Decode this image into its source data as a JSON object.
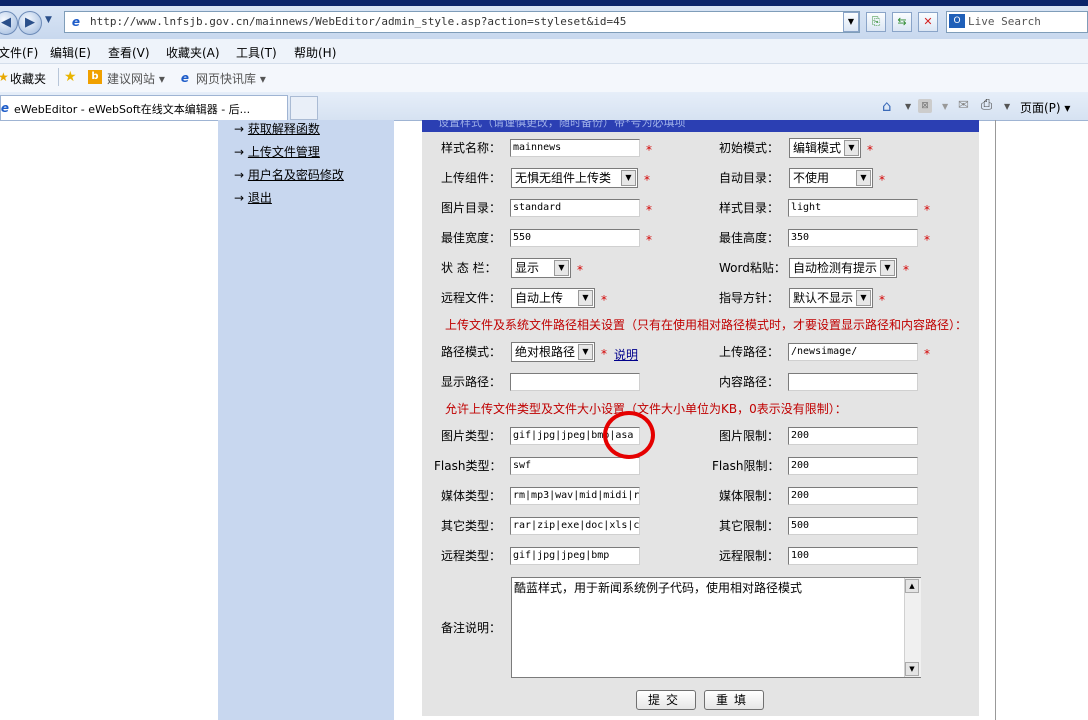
{
  "browser": {
    "url": "http://www.lnfsjb.gov.cn/mainnews/WebEditor/admin_style.asp?action=styleset&id=45",
    "search_placeholder": "Live Search",
    "menu": [
      "文件(F)",
      "编辑(E)",
      "查看(V)",
      "收藏夹(A)",
      "工具(T)",
      "帮助(H)"
    ],
    "favorites_label": "收藏夹",
    "favorites_items": [
      "建议网站 ▾",
      "网页快讯库 ▾"
    ],
    "tab_title": "eWebEditor - eWebSoft在线文本编辑器 - 后...",
    "page_menu_label": "页面(P) ▾"
  },
  "sidebar": {
    "links": [
      "获取解释函数",
      "上传文件管理",
      "用户名及密码修改",
      "退出"
    ]
  },
  "form": {
    "header_text": "设置样式（请谨慎更改，随时备份）带*号为必填项",
    "star": "*",
    "fields": {
      "style_name": {
        "label": "样式名称：",
        "value": "mainnews"
      },
      "init_mode": {
        "label": "初始模式：",
        "value": "编辑模式"
      },
      "upload_component": {
        "label": "上传组件：",
        "value": "无惧无组件上传类"
      },
      "auto_dir": {
        "label": "自动目录：",
        "value": "不使用"
      },
      "image_dir": {
        "label": "图片目录：",
        "value": "standard"
      },
      "style_dir": {
        "label": "样式目录：",
        "value": "light"
      },
      "best_width": {
        "label": "最佳宽度：",
        "value": "550"
      },
      "best_height": {
        "label": "最佳高度：",
        "value": "350"
      },
      "status_bar": {
        "label": "状 态 栏：",
        "value": "显示"
      },
      "word_paste": {
        "label": "Word粘贴：",
        "value": "自动检测有提示"
      },
      "remote_file": {
        "label": "远程文件：",
        "value": "自动上传"
      },
      "guide_policy": {
        "label": "指导方针：",
        "value": "默认不显示"
      },
      "path_mode": {
        "label": "路径模式：",
        "value": "绝对根路径",
        "help_link": "说明"
      },
      "upload_path": {
        "label": "上传路径：",
        "value": "/newsimage/"
      },
      "display_path": {
        "label": "显示路径：",
        "value": ""
      },
      "content_path": {
        "label": "内容路径：",
        "value": ""
      },
      "image_types": {
        "label": "图片类型：",
        "value": "gif|jpg|jpeg|bmp|asa"
      },
      "image_limit": {
        "label": "图片限制：",
        "value": "200"
      },
      "flash_types": {
        "label": "Flash类型：",
        "value": "swf"
      },
      "flash_limit": {
        "label": "Flash限制：",
        "value": "200"
      },
      "media_types": {
        "label": "媒体类型：",
        "value": "rm|mp3|wav|mid|midi|r"
      },
      "media_limit": {
        "label": "媒体限制：",
        "value": "200"
      },
      "other_types": {
        "label": "其它类型：",
        "value": "rar|zip|exe|doc|xls|c"
      },
      "other_limit": {
        "label": "其它限制：",
        "value": "500"
      },
      "remote_types": {
        "label": "远程类型：",
        "value": "gif|jpg|jpeg|bmp"
      },
      "remote_limit": {
        "label": "远程限制：",
        "value": "100"
      },
      "remarks": {
        "label": "备注说明：",
        "value": "酷蓝样式，用于新闻系统例子代码，使用相对路径模式"
      }
    },
    "section_path": "上传文件及系统文件路径相关设置（只有在使用相对路径模式时，才要设置显示路径和内容路径）：",
    "section_size": "允许上传文件类型及文件大小设置（文件大小单位为KB，0表示没有限制）：",
    "submit_label": "提交",
    "reset_label": "重填"
  },
  "colors": {
    "highlight_circle": "#e50000",
    "sidebar_bg": "#c8d7ef",
    "form_header": "#2b3fb3"
  }
}
